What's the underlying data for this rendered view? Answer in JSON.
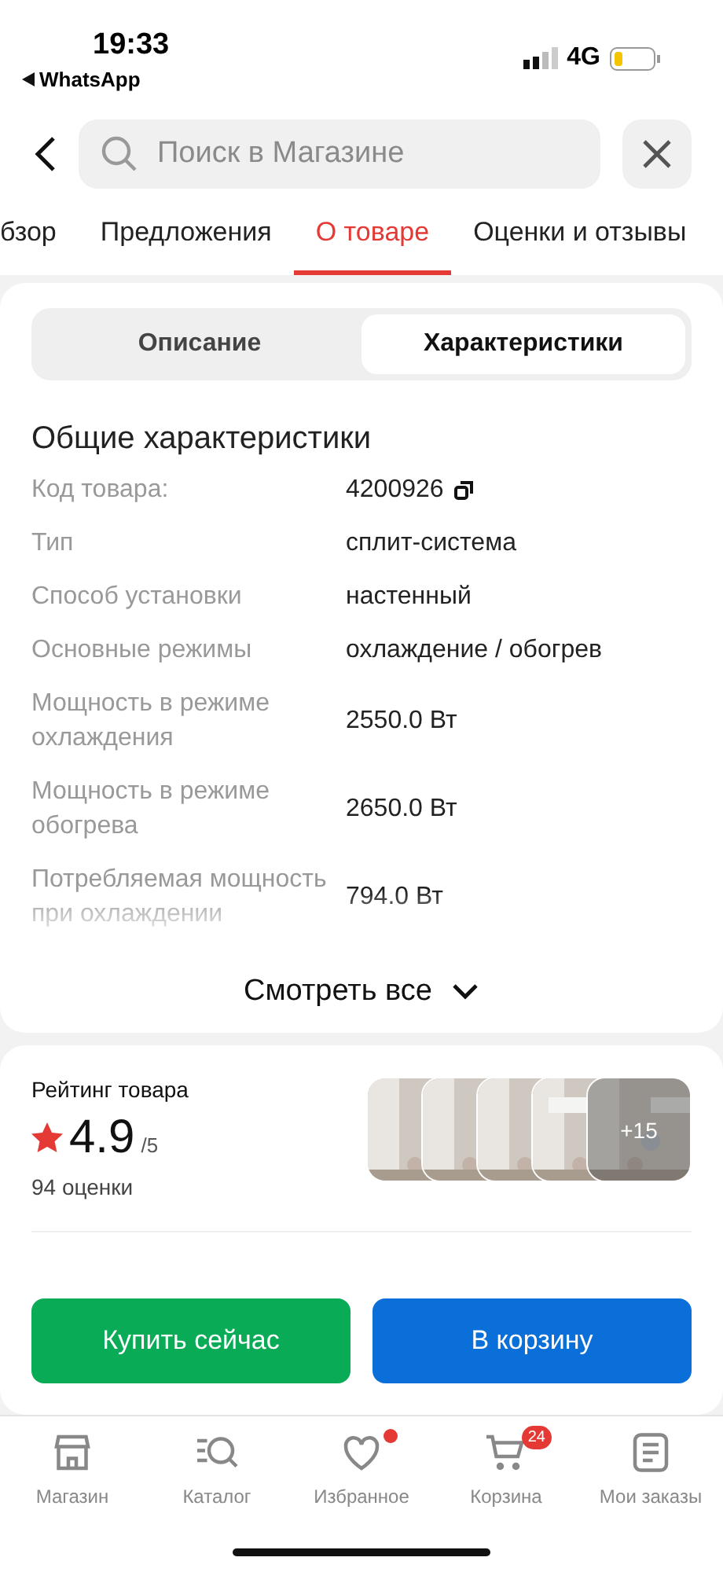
{
  "status_bar": {
    "time": "19:33",
    "back_app": "WhatsApp",
    "network": "4G"
  },
  "header": {
    "search": {
      "placeholder": "Поиск в Магазине"
    }
  },
  "tabs": [
    {
      "label": "бзор",
      "selected": false
    },
    {
      "label": "Предложения",
      "selected": false
    },
    {
      "label": "О товаре",
      "selected": true
    },
    {
      "label": "Оценки и отзывы",
      "selected": false
    }
  ],
  "segments": [
    {
      "label": "Описание",
      "selected": false
    },
    {
      "label": "Характеристики",
      "selected": true
    }
  ],
  "specs": {
    "title": "Общие характеристики",
    "rows": [
      {
        "label": "Код товара:",
        "value": "4200926",
        "copyable": true
      },
      {
        "label": "Тип",
        "value": "сплит-система",
        "copyable": false
      },
      {
        "label": "Способ установки",
        "value": "настенный",
        "copyable": false
      },
      {
        "label": "Основные режимы",
        "value": "охлаждение / обогрев",
        "copyable": false
      },
      {
        "label": "Мощность в режиме охлаждения",
        "value": "2550.0 Вт",
        "copyable": false
      },
      {
        "label": "Мощность в режиме обогрева",
        "value": "2650.0 Вт",
        "copyable": false
      },
      {
        "label": "Потребляемая мощность при охлаждении",
        "value": "794.0 Вт",
        "copyable": false
      }
    ],
    "show_all": "Смотреть все"
  },
  "rating": {
    "title": "Рейтинг товара",
    "score": "4.9",
    "scale": "/5",
    "count": "94 оценки",
    "more": "+15"
  },
  "actions": [
    {
      "label": "Купить сейчас",
      "kind": "buy"
    },
    {
      "label": "В корзину",
      "kind": "cart"
    }
  ],
  "nav": [
    {
      "label": "Магазин",
      "dot": false
    },
    {
      "label": "Каталог",
      "dot": false
    },
    {
      "label": "Избранное",
      "dot": true
    },
    {
      "label": "Корзина",
      "dot": false,
      "badge": "24"
    },
    {
      "label": "Мои заказы",
      "dot": false
    }
  ]
}
